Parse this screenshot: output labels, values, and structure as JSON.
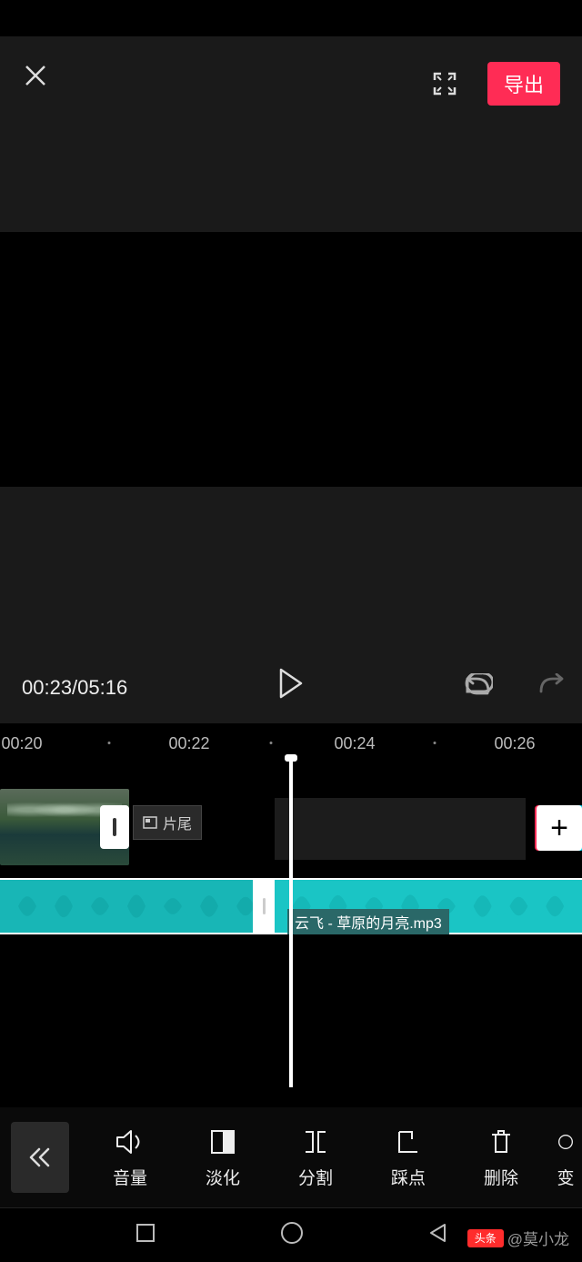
{
  "header": {
    "export_label": "导出"
  },
  "player": {
    "timecode": "00:23/05:16"
  },
  "ruler": {
    "t0": "00:20",
    "t1": "00:22",
    "t2": "00:24",
    "t3": "00:26"
  },
  "timeline": {
    "ending_label": "片尾",
    "audio_filename": "云飞 - 草原的月亮.mp3",
    "add_label": "+"
  },
  "tools": {
    "volume": "音量",
    "fade": "淡化",
    "split": "分割",
    "beat": "踩点",
    "delete": "删除",
    "speed": "变"
  },
  "watermark": {
    "badge": "头条",
    "author": "@莫小龙"
  }
}
